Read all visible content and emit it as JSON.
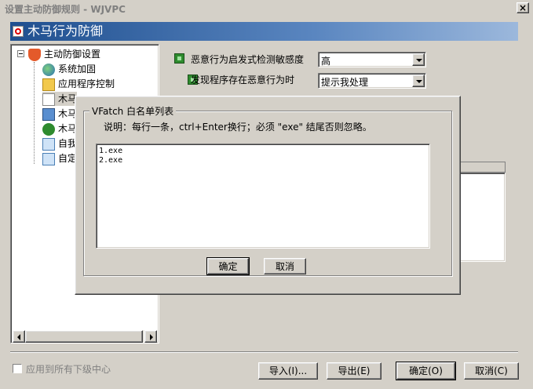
{
  "window": {
    "title": "设置主动防御规则 - WJVPC",
    "close_glyph": "×"
  },
  "header": {
    "title": "木马行为防御"
  },
  "tree": {
    "root": "主动防御设置",
    "items": [
      "系统加固",
      "应用程序控制",
      "木马",
      "木马",
      "木马",
      "自我",
      "自定"
    ]
  },
  "settings": {
    "sensitivity_label": "恶意行为启发式检测敏感度",
    "sensitivity_value": "高",
    "action_label": "发现程序存在恶意行为时",
    "action_value": "提示我处理"
  },
  "dialog": {
    "group_title": "VFatch 白名单列表",
    "description": "说明：每行一条，ctrl+Enter换行；必须 \"exe\" 结尾否则忽略。",
    "lines": [
      "1.exe",
      "2.exe"
    ],
    "ok_label": "确定",
    "cancel_label": "取消"
  },
  "footer": {
    "apply_all_label": "应用到所有下级中心",
    "import_label": "导入(I)...",
    "export_label": "导出(E)",
    "ok_label": "确定(O)",
    "cancel_label": "取消(C)"
  }
}
